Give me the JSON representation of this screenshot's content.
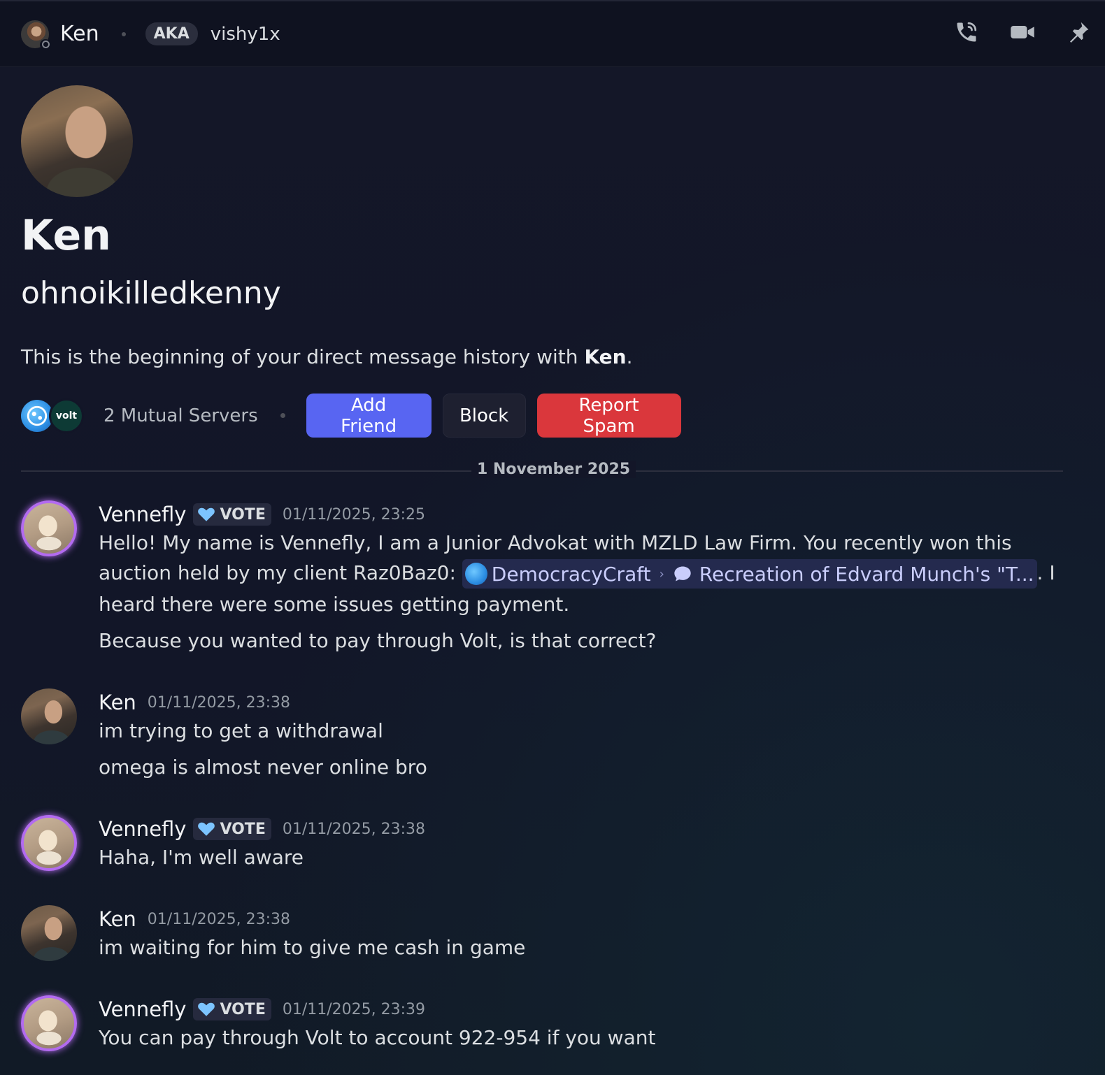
{
  "header": {
    "name": "Ken",
    "aka_label": "AKA",
    "alias": "vishy1x",
    "icons": [
      "phone-call-icon",
      "video-call-icon",
      "pin-icon"
    ]
  },
  "profile": {
    "display_name": "Ken",
    "username": "ohnoikilledkenny",
    "intro_prefix": "This is the beginning of your direct message history with ",
    "intro_name": "Ken",
    "intro_suffix": ".",
    "mutual_servers": "2 Mutual Servers",
    "server_icons": [
      "server-icon-democracycraft",
      "server-icon-volt"
    ],
    "volt_label": "volt",
    "buttons": {
      "add_friend": "Add Friend",
      "block": "Block",
      "report_spam": "Report Spam"
    }
  },
  "divider_date": "1 November 2025",
  "colors": {
    "accent": "#5865f2",
    "danger": "#da373c",
    "nitro_ring": "#b36bf0"
  },
  "messages": [
    {
      "author": "Vennefly",
      "tag": "VOTE",
      "time": "01/11/2025, 23:25",
      "line1": "Hello! My name is Vennefly, I am a Junior Advokat with MZLD Law Firm. You recently won this",
      "line2_prefix": "auction held by my client Raz0Baz0: ",
      "mention_server": "DemocracyCraft",
      "mention_channel": "Recreation of Edvard Munch's \"T...",
      "line2_suffix": ". I",
      "line3": "heard there were some issues getting payment.",
      "line4": "Because you wanted to pay through Volt, is that correct?"
    },
    {
      "author": "Ken",
      "time": "01/11/2025, 23:38",
      "line1": "im trying to get a withdrawal",
      "line2": "omega is almost never online bro"
    },
    {
      "author": "Vennefly",
      "tag": "VOTE",
      "time": "01/11/2025, 23:38",
      "line1": "Haha, I'm well aware"
    },
    {
      "author": "Ken",
      "time": "01/11/2025, 23:38",
      "line1": "im waiting for him to give me cash in game"
    },
    {
      "author": "Vennefly",
      "tag": "VOTE",
      "time": "01/11/2025, 23:39",
      "line1": "You can pay through Volt to account 922-954 if you want"
    }
  ]
}
